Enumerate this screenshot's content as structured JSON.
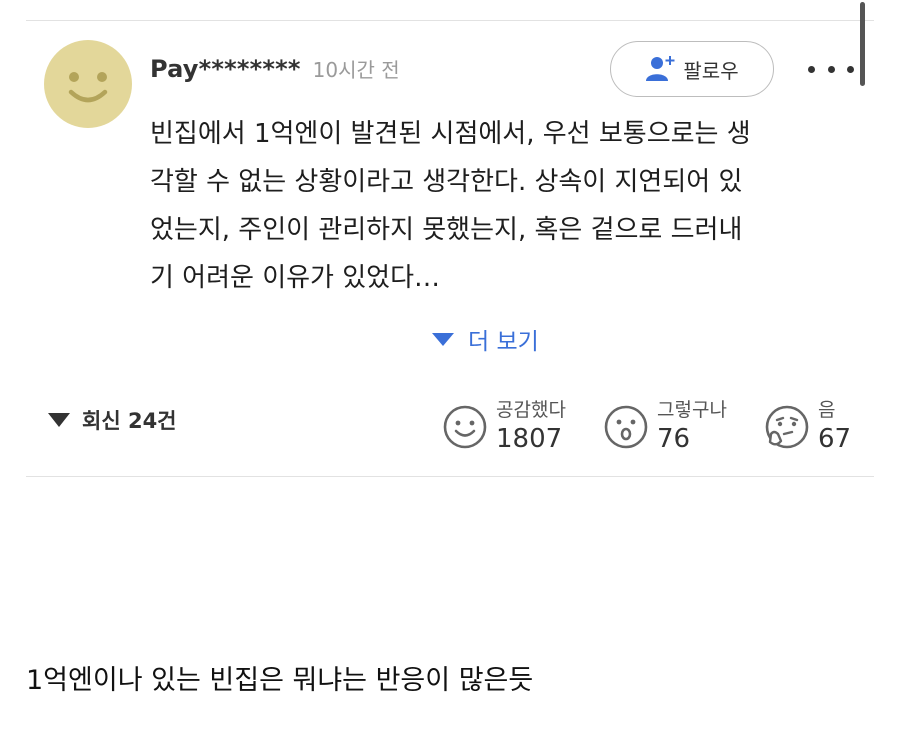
{
  "comment": {
    "username": "Pay********",
    "time": "10시간 전",
    "follow_label": "팔로우",
    "avatar_icon": "smiley-face-avatar",
    "more_icon": "more-dots-icon",
    "text": "빈집에서 1억엔이 발견된 시점에서, 우선 보통으로는 생\n각할 수 없는 상황이라고 생각한다. 상속이 지연되어 있\n었는지, 주인이 관리하지 못했는지, 혹은 겉으로 드러내\n기 어려운 이유가 있었다…",
    "show_more_label": "더 보기",
    "replies_label": "회신 24건",
    "reactions": [
      {
        "label": "공감했다",
        "count": "1807",
        "icon": "smile-icon"
      },
      {
        "label": "그렇구나",
        "count": "76",
        "icon": "surprised-icon"
      },
      {
        "label": "음",
        "count": "67",
        "icon": "thinking-icon"
      }
    ]
  },
  "caption": "1억엔이나 있는 빈집은 뭐냐는 반응이 많은듯",
  "colors": {
    "link": "#3a6fd8",
    "avatar": "#e3d79a",
    "follow_icon": "#3a6fd8",
    "divider": "#e2e2e2"
  }
}
